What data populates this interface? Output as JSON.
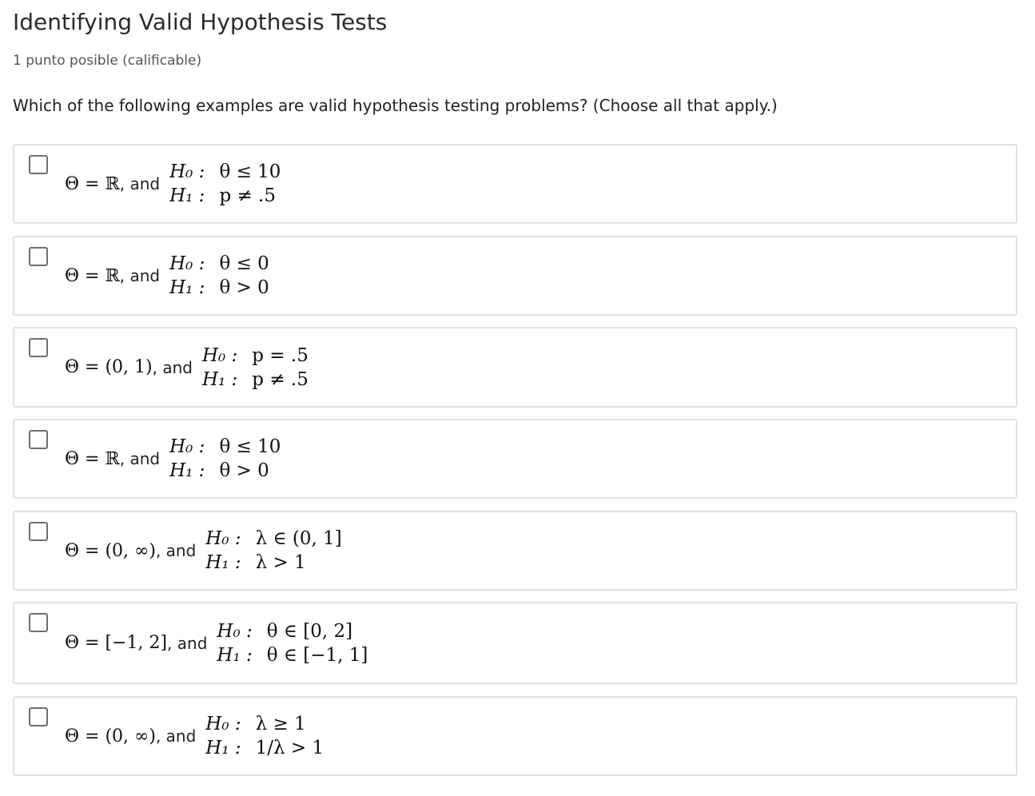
{
  "header": {
    "title": "Identifying Valid Hypothesis Tests",
    "points": "1 punto posible (calificable)"
  },
  "question": {
    "prompt": "Which of the following examples are valid hypothesis testing problems? (Choose all that apply.)"
  },
  "choices": [
    {
      "checked": false,
      "param_space": "Θ = ℝ",
      "connector": ", and",
      "h0_label": "H₀ :",
      "h0_expr": "θ ≤ 10",
      "h1_label": "H₁ :",
      "h1_expr": "p ≠ .5"
    },
    {
      "checked": false,
      "param_space": "Θ = ℝ",
      "connector": ", and",
      "h0_label": "H₀ :",
      "h0_expr": "θ ≤ 0",
      "h1_label": "H₁ :",
      "h1_expr": "θ > 0"
    },
    {
      "checked": false,
      "param_space": "Θ = (0, 1)",
      "connector": ", and",
      "h0_label": "H₀ :",
      "h0_expr": "p = .5",
      "h1_label": "H₁ :",
      "h1_expr": "p ≠ .5"
    },
    {
      "checked": false,
      "param_space": "Θ = ℝ",
      "connector": ", and",
      "h0_label": "H₀ :",
      "h0_expr": "θ ≤ 10",
      "h1_label": "H₁ :",
      "h1_expr": "θ > 0"
    },
    {
      "checked": false,
      "param_space": "Θ = (0, ∞)",
      "connector": ", and",
      "h0_label": "H₀ :",
      "h0_expr": "λ ∈ (0, 1]",
      "h1_label": "H₁ :",
      "h1_expr": "λ > 1"
    },
    {
      "checked": false,
      "param_space": "Θ = [−1, 2]",
      "connector": ", and",
      "h0_label": "H₀ :",
      "h0_expr": "θ ∈ [0, 2]",
      "h1_label": "H₁ :",
      "h1_expr": "θ ∈ [−1, 1]"
    },
    {
      "checked": false,
      "param_space": "Θ = (0, ∞)",
      "connector": ", and",
      "h0_label": "H₀ :",
      "h0_expr": "λ ≥ 1",
      "h1_label": "H₁ :",
      "h1_expr": "1/λ > 1"
    }
  ]
}
